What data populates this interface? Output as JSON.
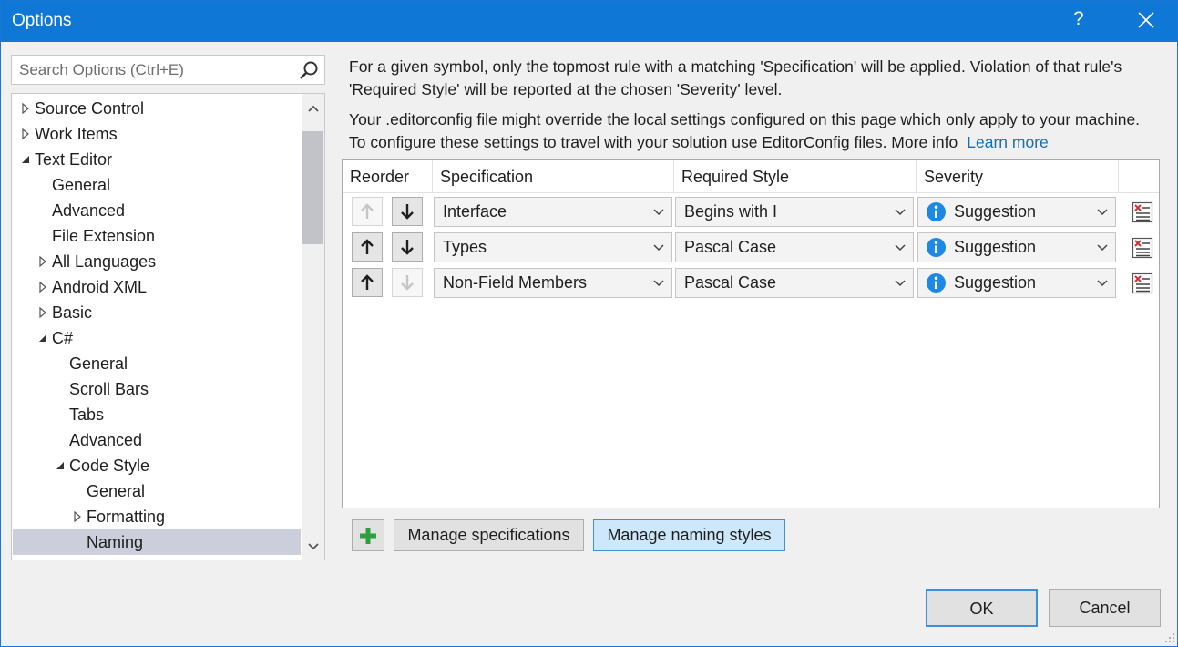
{
  "window": {
    "title": "Options",
    "help_glyph": "?",
    "close_glyph": "✕"
  },
  "search": {
    "placeholder": "Search Options (Ctrl+E)"
  },
  "tree": {
    "items": [
      {
        "label": "Source Control",
        "expand": "collapsed"
      },
      {
        "label": "Work Items",
        "expand": "collapsed"
      },
      {
        "label": "Text Editor",
        "expand": "expanded"
      },
      {
        "label": "General",
        "expand": "none"
      },
      {
        "label": "Advanced",
        "expand": "none"
      },
      {
        "label": "File Extension",
        "expand": "none"
      },
      {
        "label": "All Languages",
        "expand": "collapsed"
      },
      {
        "label": "Android XML",
        "expand": "collapsed"
      },
      {
        "label": "Basic",
        "expand": "collapsed"
      },
      {
        "label": "C#",
        "expand": "expanded"
      },
      {
        "label": "General",
        "expand": "none"
      },
      {
        "label": "Scroll Bars",
        "expand": "none"
      },
      {
        "label": "Tabs",
        "expand": "none"
      },
      {
        "label": "Advanced",
        "expand": "none"
      },
      {
        "label": "Code Style",
        "expand": "expanded"
      },
      {
        "label": "General",
        "expand": "none"
      },
      {
        "label": "Formatting",
        "expand": "collapsed"
      },
      {
        "label": "Naming",
        "expand": "none",
        "selected": true
      }
    ]
  },
  "description": {
    "line1": "For a given symbol, only the topmost rule with a matching 'Specification' will be applied. Violation of that rule's 'Required Style' will be reported at the chosen 'Severity' level.",
    "line2": "Your .editorconfig file might override the local settings configured on this page which only apply to your machine. To configure these settings to travel with your solution use EditorConfig files. More info",
    "learn_more": "Learn more"
  },
  "grid": {
    "headers": {
      "reorder": "Reorder",
      "specification": "Specification",
      "required_style": "Required Style",
      "severity": "Severity"
    },
    "rows": [
      {
        "specification": "Interface",
        "required_style": "Begins with I",
        "severity": "Suggestion",
        "up_enabled": false,
        "down_enabled": true
      },
      {
        "specification": "Types",
        "required_style": "Pascal Case",
        "severity": "Suggestion",
        "up_enabled": true,
        "down_enabled": true
      },
      {
        "specification": "Non-Field Members",
        "required_style": "Pascal Case",
        "severity": "Suggestion",
        "up_enabled": true,
        "down_enabled": false
      }
    ]
  },
  "buttons": {
    "manage_specifications": "Manage specifications",
    "manage_naming_styles": "Manage naming styles",
    "ok": "OK",
    "cancel": "Cancel"
  },
  "colors": {
    "title_bar": "#0f78d7",
    "link": "#0e70c0",
    "selected_tree": "#cccedb",
    "info": "#1e88e5",
    "add_green": "#2e9e3f"
  }
}
